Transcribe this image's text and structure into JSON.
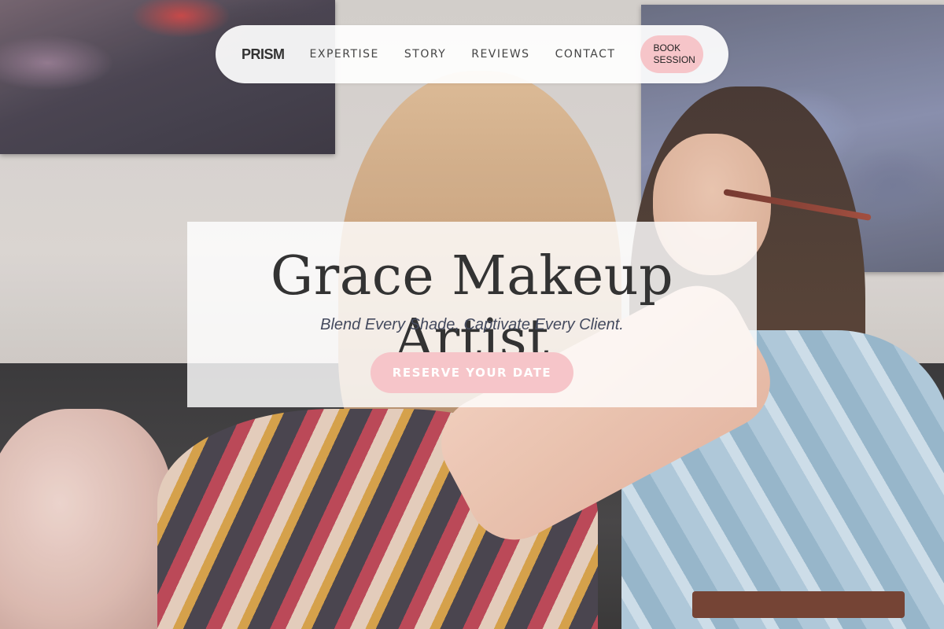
{
  "nav": {
    "brand": "PRISM",
    "links": [
      {
        "label": "EXPERTISE"
      },
      {
        "label": "STORY"
      },
      {
        "label": "REVIEWS"
      },
      {
        "label": "CONTACT"
      }
    ],
    "cta_label": "BOOK SESSION"
  },
  "hero": {
    "title": "Grace Makeup Artist",
    "tagline": "Blend Every Shade, Captivate Every Client.",
    "cta_label": "RESERVE YOUR DATE"
  },
  "colors": {
    "accent_pink": "#f6c5c9",
    "text_dark": "#333333",
    "tagline": "#444a5e"
  },
  "background_image": "makeup artist applying eyeshadow to a client"
}
